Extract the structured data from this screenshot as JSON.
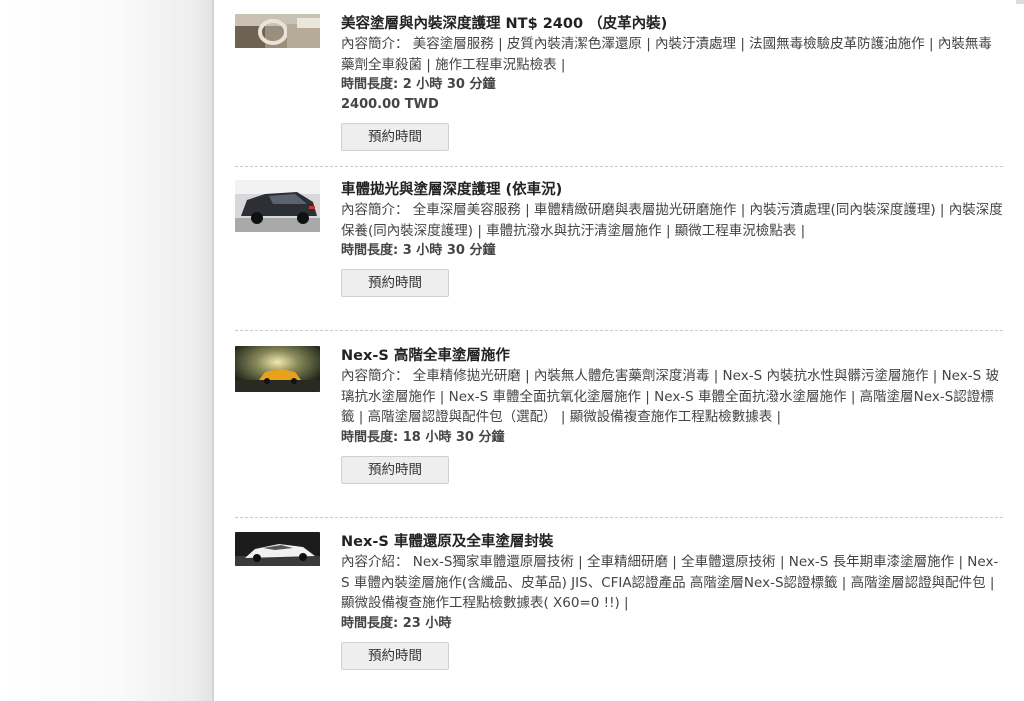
{
  "services": [
    {
      "title": "美容塗層與內裝深度護理 NT$ 2400 （皮革內裝)",
      "description": "內容簡介： 美容塗層服務 | 皮質內裝清潔色澤還原 | 內裝汙漬處理 | 法國無毒檢驗皮革防護油施作 | 內裝無毒藥劑全車殺菌 | 施作工程車況點檢表 |",
      "duration": "時間長度: 2 小時 30 分鐘",
      "price": "2400.00 TWD",
      "button_label": "預約時間",
      "thumbnail_icon": "car-interior-photo"
    },
    {
      "title": "車體拋光與塗層深度護理 (依車況)",
      "description": "內容簡介： 全車深層美容服務 | 車體精緻研磨與表層拋光研磨施作 | 內裝污漬處理(同內裝深度護理) | 內裝深度保養(同內裝深度護理) | 車體抗潑水與抗汙清塗層施作 | 顯微工程車況檢點表 |",
      "duration": "時間長度: 3 小時 30 分鐘",
      "button_label": "預約時間",
      "thumbnail_icon": "hatchback-rear-photo"
    },
    {
      "title": "Nex-S 高階全車塗層施作",
      "description": "內容簡介： 全車精修拋光研磨 | 內裝無人體危害藥劑深度消毒 | Nex-S 內裝抗水性與髒污塗層施作 | Nex-S 玻璃抗水塗層施作 | Nex-S 車體全面抗氧化塗層施作 | Nex-S 車體全面抗潑水塗層施作 | 高階塗層Nex-S認證標籤 | 高階塗層認證與配件包（選配） | 顯微設備複查施作工程點檢數據表 |",
      "duration": "時間長度: 18 小時 30 分鐘",
      "button_label": "預約時間",
      "thumbnail_icon": "sports-car-sunset-photo"
    },
    {
      "title": "Nex-S 車體還原及全車塗層封裝",
      "description": "內容介紹： Nex-S獨家車體還原層技術 | 全車精細研磨 | 全車體還原技術 | Nex-S 長年期車漆塗層施作 | Nex-S 車體內裝塗層施作(含纖品、皮革品) JIS、CFIA認證產品 高階塗層Nex-S認證標籤 | 高階塗層認證與配件包 | 顯微設備複查施作工程點檢數據表( X60=0 !!) |",
      "duration": "時間長度: 23 小時",
      "button_label": "預約時間",
      "thumbnail_icon": "white-supercar-photo"
    }
  ]
}
